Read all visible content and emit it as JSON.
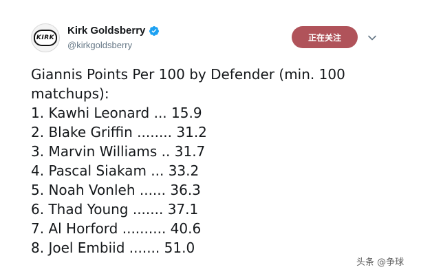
{
  "header": {
    "display_name": "Kirk Goldsberry",
    "handle": "@kirkgoldsberry",
    "avatar_text": "KIRK",
    "verified_icon": "verified-badge-icon",
    "follow_label": "正在关注",
    "menu_icon": "chevron-down-icon"
  },
  "tweet": {
    "title_line1": "Giannis Points Per 100 by Defender (min. 100",
    "title_line2": "matchups):",
    "items": [
      "1. Kawhi Leonard ... 15.9",
      "2. Blake Griffin ........ 31.2",
      "3. Marvin Williams .. 31.7",
      "4. Pascal Siakam ... 33.2",
      "5. Noah Vonleh ...... 36.3",
      "6. Thad Young ....... 37.1",
      "7. Al Horford .......... 40.6",
      "8. Joel Embiid ....... 51.0"
    ]
  },
  "watermark": "头条 @争球",
  "colors": {
    "follow_button_bg": "#b0535a",
    "verified_blue": "#1da1f2",
    "handle_gray": "#657786"
  }
}
